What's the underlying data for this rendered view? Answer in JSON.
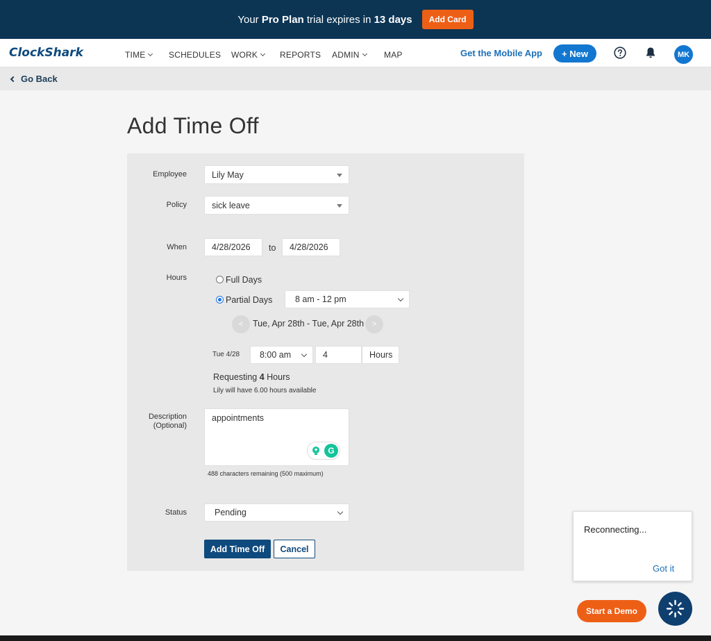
{
  "banner": {
    "prefix": "Your ",
    "plan": "Pro Plan",
    "middle": " trial expires in ",
    "days": "13 days",
    "add_card_label": "Add Card"
  },
  "nav": {
    "logo": "ClockShark",
    "items": [
      {
        "label": "TIME",
        "has_dropdown": true
      },
      {
        "label": "SCHEDULES",
        "has_dropdown": false
      },
      {
        "label": "WORK",
        "has_dropdown": true
      },
      {
        "label": "REPORTS",
        "has_dropdown": false
      },
      {
        "label": "ADMIN",
        "has_dropdown": true
      },
      {
        "label": "MAP",
        "has_dropdown": false
      }
    ],
    "mobile_app": "Get the Mobile App",
    "new_label": "+ New",
    "help_icon": "question-circle-icon",
    "bell_icon": "bell-icon",
    "avatar": "MK"
  },
  "back": {
    "label": "Go Back"
  },
  "page": {
    "title": "Add Time Off"
  },
  "form": {
    "employee": {
      "label": "Employee",
      "value": "Lily May"
    },
    "policy": {
      "label": "Policy",
      "value": "sick leave"
    },
    "when": {
      "label": "When",
      "start": "4/28/2026",
      "separator": "to",
      "end": "4/28/2026"
    },
    "hours": {
      "label": "Hours",
      "full_days": "Full Days",
      "partial_days": "Partial Days",
      "selected": "partial",
      "partial_range": "8 am - 12 pm",
      "prev_arrow": "<",
      "next_arrow": ">",
      "date_range": "Tue, Apr 28th - Tue, Apr 28th",
      "day_label": "Tue 4/28",
      "start_time": "8:00 am",
      "hours_value": "4",
      "hours_unit": "Hours",
      "requesting_prefix": "Requesting ",
      "requesting_count": "4",
      "requesting_suffix": " Hours",
      "available_note": "Lily will have 6.00 hours available"
    },
    "description": {
      "label_line1": "Description",
      "label_line2": "(Optional)",
      "value": "appointments",
      "remaining": "488 characters remaining (500 maximum)"
    },
    "status": {
      "label": "Status",
      "value": "Pending"
    },
    "submit_label": "Add Time Off",
    "cancel_label": "Cancel"
  },
  "toast": {
    "message": "Reconnecting...",
    "dismiss_label": "Got it"
  },
  "demo": {
    "label": "Start a Demo"
  },
  "colors": {
    "banner_bg": "#0c3554",
    "accent_orange": "#ee5f16",
    "primary_blue": "#0e4a7d",
    "link_blue": "#1d70b8",
    "grammarly_green": "#15c39a"
  }
}
